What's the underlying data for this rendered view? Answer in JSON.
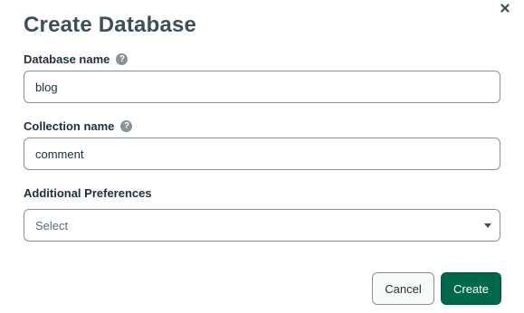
{
  "dialog": {
    "title": "Create Database",
    "close_icon": "close-icon"
  },
  "database_name": {
    "label": "Database name",
    "help_icon": "help-icon",
    "value": "blog"
  },
  "collection_name": {
    "label": "Collection name",
    "help_icon": "help-icon",
    "value": "comment"
  },
  "additional_preferences": {
    "label": "Additional Preferences",
    "selected": "Select",
    "caret_icon": "caret-down-icon"
  },
  "actions": {
    "cancel_label": "Cancel",
    "create_label": "Create"
  },
  "colors": {
    "primary": "#00684a",
    "title": "#3d4f58",
    "border": "#889397"
  }
}
